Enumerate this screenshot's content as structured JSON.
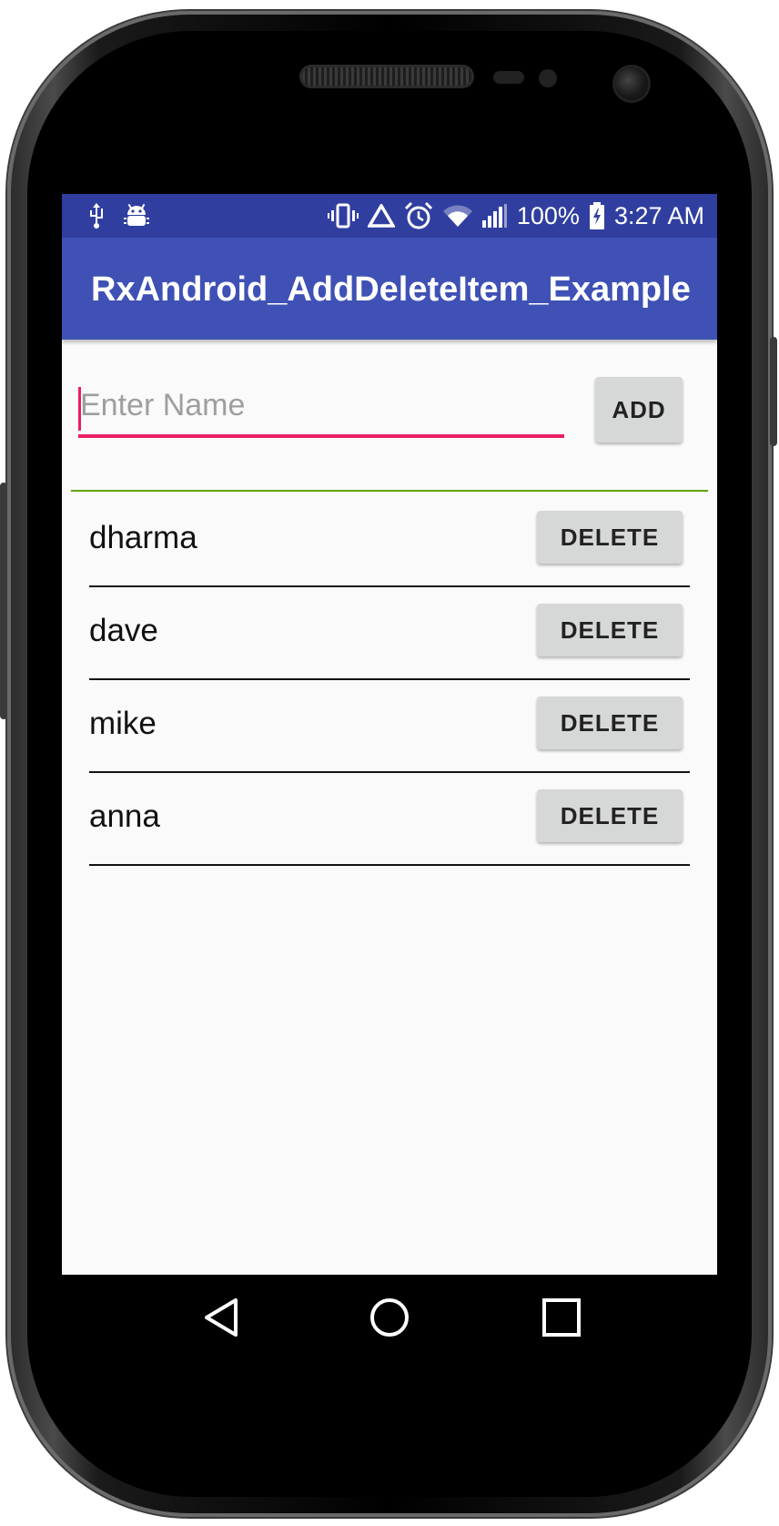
{
  "status_bar": {
    "battery_percent": "100%",
    "time": "3:27 AM",
    "left_icons": [
      "usb-icon",
      "android-debug-icon"
    ],
    "right_icons": [
      "vibrate-icon",
      "network-triangle-icon",
      "alarm-icon",
      "wifi-icon",
      "cell-signal-icon",
      "battery-charging-icon"
    ]
  },
  "app_bar": {
    "title": "RxAndroid_AddDeleteItem_Example"
  },
  "form": {
    "name_placeholder": "Enter Name",
    "name_value": "",
    "add_label": "ADD"
  },
  "items": [
    {
      "name": "dharma",
      "delete_label": "DELETE"
    },
    {
      "name": "dave",
      "delete_label": "DELETE"
    },
    {
      "name": "mike",
      "delete_label": "DELETE"
    },
    {
      "name": "anna",
      "delete_label": "DELETE"
    }
  ],
  "nav_bar": {
    "buttons": [
      "back-icon",
      "home-icon",
      "recents-icon"
    ]
  },
  "colors": {
    "status_bar": "#303f9f",
    "app_bar": "#3f51b5",
    "accent": "#e91e63",
    "divider_green": "#5fa30a",
    "button_bg": "#d6d7d7"
  }
}
